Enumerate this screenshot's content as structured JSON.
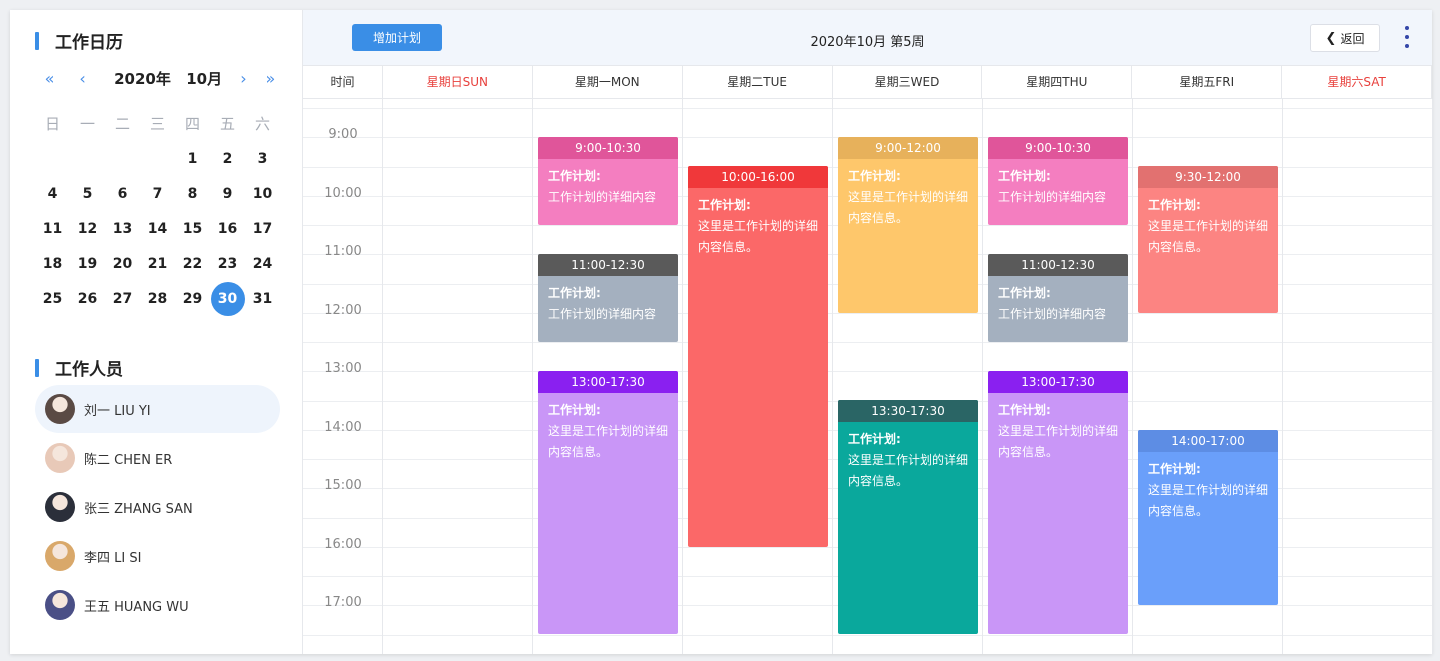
{
  "sidebar": {
    "calendar_title": "工作日历",
    "nav": {
      "prev_year": "«",
      "prev_month": "‹",
      "year": "2020年",
      "month": "10月",
      "next_month": "›",
      "next_year": "»"
    },
    "weekdays": [
      "日",
      "一",
      "二",
      "三",
      "四",
      "五",
      "六"
    ],
    "weeks": [
      [
        "",
        "",
        "",
        "",
        "1",
        "2",
        "3"
      ],
      [
        "4",
        "5",
        "6",
        "7",
        "8",
        "9",
        "10"
      ],
      [
        "11",
        "12",
        "13",
        "14",
        "15",
        "16",
        "17"
      ],
      [
        "18",
        "19",
        "20",
        "21",
        "22",
        "23",
        "24"
      ],
      [
        "25",
        "26",
        "27",
        "28",
        "29",
        "30",
        "31"
      ]
    ],
    "selected_day": "30",
    "staff_title": "工作人员",
    "staff": [
      {
        "name": "刘一 LIU YI",
        "active": true,
        "color": "#5a4a44"
      },
      {
        "name": "陈二 CHEN ER",
        "active": false,
        "color": "#e8c9b8"
      },
      {
        "name": "张三 ZHANG SAN",
        "active": false,
        "color": "#2b2f3a"
      },
      {
        "name": "李四 LI SI",
        "active": false,
        "color": "#d9a86a"
      },
      {
        "name": "王五 HUANG WU",
        "active": false,
        "color": "#4a4f86"
      }
    ]
  },
  "topbar": {
    "add_label": "增加计划",
    "week_title": "2020年10月 第5周",
    "back_label": "返回"
  },
  "grid": {
    "time_header": "时间",
    "days": [
      {
        "label": "星期日SUN",
        "weekend": true
      },
      {
        "label": "星期一MON",
        "weekend": false
      },
      {
        "label": "星期二TUE",
        "weekend": false
      },
      {
        "label": "星期三WED",
        "weekend": false
      },
      {
        "label": "星期四THU",
        "weekend": false
      },
      {
        "label": "星期五FRI",
        "weekend": false
      },
      {
        "label": "星期六SAT",
        "weekend": true
      }
    ],
    "hours": [
      "9:00",
      "10:00",
      "11:00",
      "12:00",
      "13:00",
      "14:00",
      "15:00",
      "16:00",
      "17:00"
    ]
  },
  "events": [
    {
      "day": 1,
      "start": 9.0,
      "end": 10.5,
      "time": "9:00-10:30",
      "title": "工作计划:",
      "body": "工作计划的详细内容",
      "head_color": "#e0559a",
      "body_color": "#f47ec0"
    },
    {
      "day": 1,
      "start": 11.0,
      "end": 12.5,
      "time": "11:00-12:30",
      "title": "工作计划:",
      "body": "工作计划的详细内容",
      "head_color": "#5a5a5a",
      "body_color": "#a4b0bf"
    },
    {
      "day": 1,
      "start": 13.0,
      "end": 17.5,
      "time": "13:00-17:30",
      "title": "工作计划:",
      "body": "这里是工作计划的详细内容信息。",
      "head_color": "#8a20f0",
      "body_color": "#c996f7"
    },
    {
      "day": 2,
      "start": 9.5,
      "end": 16.0,
      "time": "10:00-16:00",
      "title": "工作计划:",
      "body": "这里是工作计划的详细内容信息。",
      "head_color": "#f0383a",
      "body_color": "#fb6868"
    },
    {
      "day": 3,
      "start": 9.0,
      "end": 12.0,
      "time": "9:00-12:00",
      "title": "工作计划:",
      "body": "这里是工作计划的详细内容信息。",
      "head_color": "#e7b15b",
      "body_color": "#fec76b"
    },
    {
      "day": 3,
      "start": 13.5,
      "end": 17.5,
      "time": "13:30-17:30",
      "title": "工作计划:",
      "body": "这里是工作计划的详细内容信息。",
      "head_color": "#2a6565",
      "body_color": "#0aa89c"
    },
    {
      "day": 4,
      "start": 9.0,
      "end": 10.5,
      "time": "9:00-10:30",
      "title": "工作计划:",
      "body": "工作计划的详细内容",
      "head_color": "#e0559a",
      "body_color": "#f47ec0"
    },
    {
      "day": 4,
      "start": 11.0,
      "end": 12.5,
      "time": "11:00-12:30",
      "title": "工作计划:",
      "body": "工作计划的详细内容",
      "head_color": "#5a5a5a",
      "body_color": "#a4b0bf"
    },
    {
      "day": 4,
      "start": 13.0,
      "end": 17.5,
      "time": "13:00-17:30",
      "title": "工作计划:",
      "body": "这里是工作计划的详细内容信息。",
      "head_color": "#8a20f0",
      "body_color": "#c996f7"
    },
    {
      "day": 5,
      "start": 9.5,
      "end": 12.0,
      "time": "9:30-12:00",
      "title": "工作计划:",
      "body": "这里是工作计划的详细内容信息。",
      "head_color": "#e27170",
      "body_color": "#fc8482"
    },
    {
      "day": 5,
      "start": 14.0,
      "end": 17.0,
      "time": "14:00-17:00",
      "title": "工作计划:",
      "body": "这里是工作计划的详细内容信息。",
      "head_color": "#5d8de4",
      "body_color": "#6a9ffa"
    }
  ]
}
